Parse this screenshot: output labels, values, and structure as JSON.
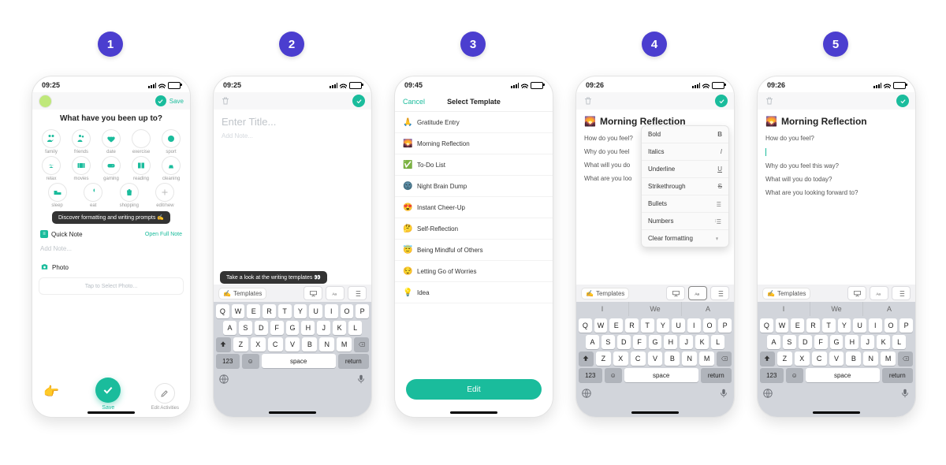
{
  "badges": [
    "1",
    "2",
    "3",
    "4",
    "5"
  ],
  "times": {
    "s1": "09:25",
    "s2": "09:25",
    "s3": "09:45",
    "s4": "09:26",
    "s5": "09:26"
  },
  "screen1": {
    "save": "Save",
    "heading": "What have you been up to?",
    "activities": [
      {
        "id": "family",
        "label": "family"
      },
      {
        "id": "friends",
        "label": "friends"
      },
      {
        "id": "date",
        "label": "date"
      },
      {
        "id": "exercise",
        "label": "exercise"
      },
      {
        "id": "sport",
        "label": "sport"
      },
      {
        "id": "relax",
        "label": "relax"
      },
      {
        "id": "movies",
        "label": "movies"
      },
      {
        "id": "gaming",
        "label": "gaming"
      },
      {
        "id": "reading",
        "label": "reading"
      },
      {
        "id": "cleaning",
        "label": "cleaning"
      },
      {
        "id": "sleep",
        "label": "sleep"
      },
      {
        "id": "eat",
        "label": "eat"
      },
      {
        "id": "shopping",
        "label": "shopping"
      },
      {
        "id": "edit",
        "label": "edit/new"
      }
    ],
    "tooltip": "Discover formatting and writing prompts ✍️",
    "quick_note": "Quick Note",
    "open_full": "Open Full Note",
    "add_note": "Add Note...",
    "photo": "Photo",
    "tap_photo": "Tap to Select Photo...",
    "save_btn": "Save",
    "edit_activities": "Edit Activities"
  },
  "editor": {
    "title_placeholder": "Enter Title...",
    "add_note_placeholder": "Add Note...",
    "tooltip": "Take a look at the writing templates 👀",
    "templates_label": "Templates",
    "templates_emoji": "✍️"
  },
  "screen3": {
    "cancel": "Cancel",
    "title": "Select Template",
    "items": [
      {
        "emoji": "🙏",
        "label": "Gratitude Entry"
      },
      {
        "emoji": "🌄",
        "label": "Morning Reflection"
      },
      {
        "emoji": "✅",
        "label": "To-Do List"
      },
      {
        "emoji": "🌚",
        "label": "Night Brain Dump"
      },
      {
        "emoji": "😍",
        "label": "Instant Cheer-Up"
      },
      {
        "emoji": "🤔",
        "label": "Self-Reflection"
      },
      {
        "emoji": "😇",
        "label": "Being Mindful of Others"
      },
      {
        "emoji": "😌",
        "label": "Letting Go of Worries"
      },
      {
        "emoji": "💡",
        "label": "Idea"
      }
    ],
    "edit": "Edit"
  },
  "morning": {
    "emoji": "🌄",
    "title": "Morning Reflection",
    "prompts": [
      "How do you feel?",
      "Why do you feel this way?",
      "What will you do today?",
      "What are you looking forward to?"
    ],
    "prompts_short": [
      "How do you feel?",
      "Why do you feel",
      "What will you do",
      "What are you loo"
    ]
  },
  "format_menu": [
    {
      "label": "Bold",
      "sym": "B",
      "style": "bold"
    },
    {
      "label": "Italics",
      "sym": "I",
      "style": "italics"
    },
    {
      "label": "Underline",
      "sym": "U",
      "style": "underline"
    },
    {
      "label": "Strikethrough",
      "sym": "S",
      "style": "strike"
    },
    {
      "label": "Bullets",
      "sym": "list",
      "style": "icon"
    },
    {
      "label": "Numbers",
      "sym": "numlist",
      "style": "icon"
    },
    {
      "label": "Clear formatting",
      "sym": "clear",
      "style": "icon"
    }
  ],
  "keyboard": {
    "predictions": [
      "I",
      "We",
      "A"
    ],
    "row1": [
      "Q",
      "W",
      "E",
      "R",
      "T",
      "Y",
      "U",
      "I",
      "O",
      "P"
    ],
    "row2": [
      "A",
      "S",
      "D",
      "F",
      "G",
      "H",
      "J",
      "K",
      "L"
    ],
    "row3": [
      "Z",
      "X",
      "C",
      "V",
      "B",
      "N",
      "M"
    ],
    "num": "123",
    "space": "space",
    "return": "return"
  }
}
